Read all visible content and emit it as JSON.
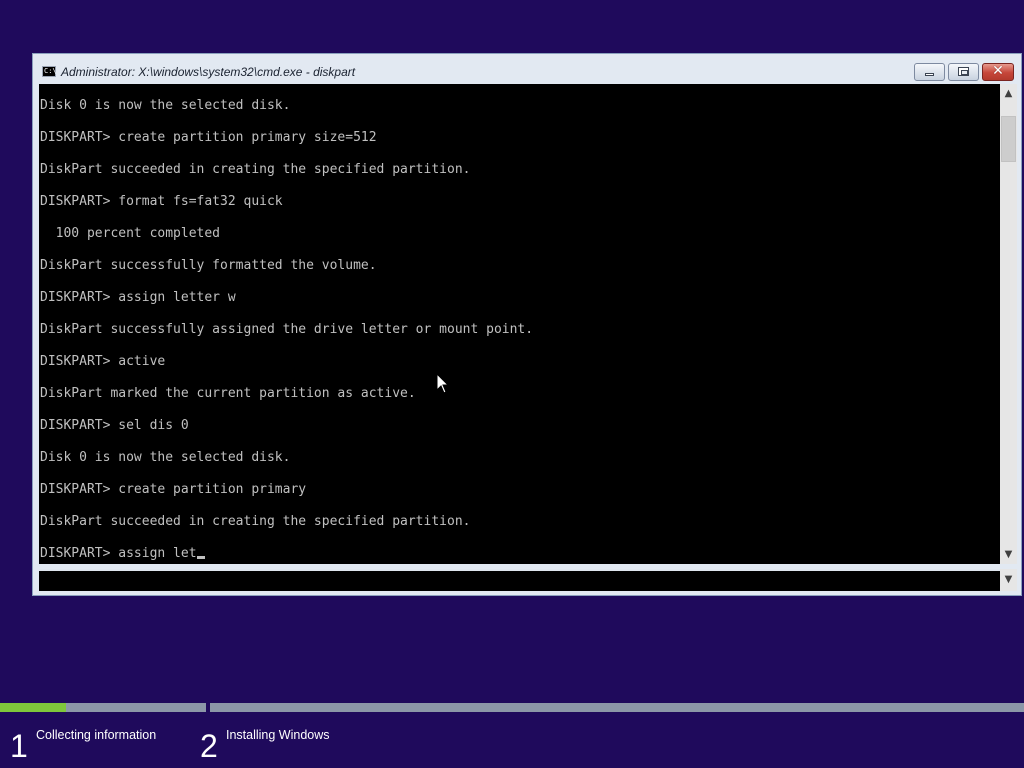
{
  "window": {
    "title": "Administrator: X:\\windows\\system32\\cmd.exe - diskpart",
    "icon_label": "C:\\",
    "controls": [
      "minimize-icon",
      "maximize-icon",
      "close-icon"
    ],
    "close_glyph": "✕"
  },
  "console": {
    "lines": [
      "Disk 0 is now the selected disk.",
      "DISKPART> create partition primary size=512",
      "DiskPart succeeded in creating the specified partition.",
      "DISKPART> format fs=fat32 quick",
      "  100 percent completed",
      "DiskPart successfully formatted the volume.",
      "DISKPART> assign letter w",
      "DiskPart successfully assigned the drive letter or mount point.",
      "DISKPART> active",
      "DiskPart marked the current partition as active.",
      "DISKPART> sel dis 0",
      "Disk 0 is now the selected disk.",
      "DISKPART> create partition primary",
      "DiskPart succeeded in creating the specified partition."
    ],
    "current_input": "DISKPART> assign let",
    "scroll_up_glyph": "▲",
    "scroll_down_glyph": "▼",
    "hscroll_glyph": "▼"
  },
  "setup": {
    "steps": [
      {
        "number": "1",
        "label": "Collecting information"
      },
      {
        "number": "2",
        "label": "Installing Windows"
      }
    ],
    "step1_progress": 0.32,
    "colors": {
      "background": "#1f0a5c",
      "progress_fill": "#7fc73b",
      "progress_track": "#8c97a8"
    }
  }
}
